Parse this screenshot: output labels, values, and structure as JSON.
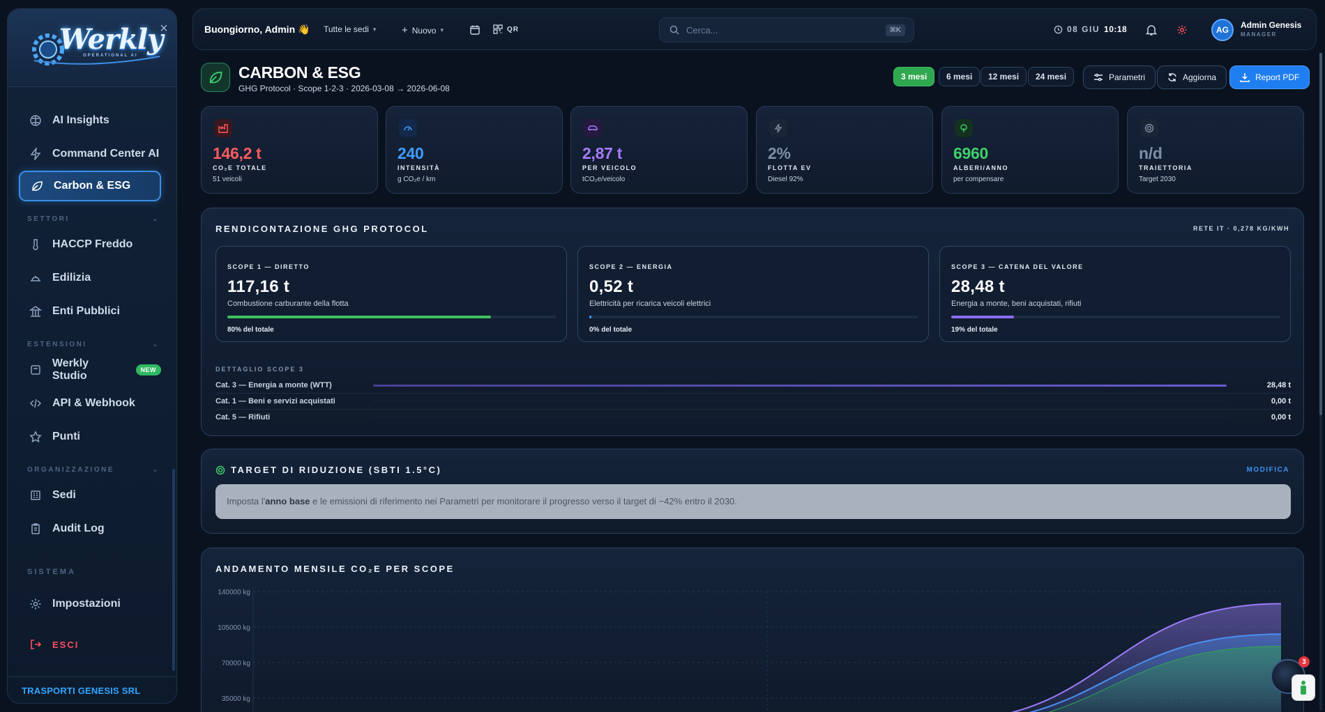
{
  "sidebar": {
    "logo_text": "Werkly",
    "logo_sub": "OPERATIONAL AI",
    "items": [
      {
        "label": "AI Insights",
        "icon": "brain-icon"
      },
      {
        "label": "Command Center AI",
        "icon": "bolt-icon"
      },
      {
        "label": "Carbon & ESG",
        "icon": "leaf-icon"
      },
      {
        "label": "HACCP Freddo",
        "icon": "thermometer-icon"
      },
      {
        "label": "Edilizia",
        "icon": "helmet-icon"
      },
      {
        "label": "Enti Pubblici",
        "icon": "building-icon"
      },
      {
        "label": "Werkly Studio",
        "icon": "studio-icon"
      },
      {
        "label": "API & Webhook",
        "icon": "code-icon"
      },
      {
        "label": "Punti",
        "icon": "star-icon"
      },
      {
        "label": "Sedi",
        "icon": "office-icon"
      },
      {
        "label": "Audit Log",
        "icon": "clipboard-icon"
      },
      {
        "label": "Impostazioni",
        "icon": "gear-icon"
      },
      {
        "label": "ESCI",
        "icon": "logout-icon"
      }
    ],
    "sections": {
      "settori": "SETTORI",
      "estensioni": "ESTENSIONI",
      "organizzazione": "ORGANIZZAZIONE",
      "sistema": "SISTEMA"
    },
    "new_badge": "NEW",
    "footer_company": "TRASPORTI GENESIS SRL",
    "accent": "#3a8ee8"
  },
  "topbar": {
    "greeting": "Buongiorno, Admin 👋",
    "sites_filter": "Tutte le sedi",
    "new_label": "Nuovo",
    "qr_label": "QR",
    "search_placeholder": "Cerca...",
    "search_shortcut": "⌘K",
    "date": "08 GIU",
    "time": "10:18",
    "user_initials": "AG",
    "user_name": "Admin Genesis",
    "user_role": "MANAGER"
  },
  "page": {
    "title": "CARBON & ESG",
    "subtitle": "GHG Protocol · Scope 1-2-3 · 2026-03-08 → 2026-06-08",
    "ranges": [
      "3 mesi",
      "6 mesi",
      "12 mesi",
      "24 mesi"
    ],
    "active_range": "3 mesi",
    "actions": {
      "params": "Parametri",
      "refresh": "Aggiorna",
      "report": "Report PDF"
    }
  },
  "kpis": [
    {
      "value": "146,2 t",
      "label": "CO₂E TOTALE",
      "sub": "51 veicoli",
      "color": "#ff5b60",
      "icon": "factory-icon"
    },
    {
      "value": "240",
      "label": "INTENSITÀ",
      "sub": "g CO₂e / km",
      "color": "#3f9bff",
      "icon": "gauge-icon"
    },
    {
      "value": "2,87 t",
      "label": "PER VEICOLO",
      "sub": "tCO₂e/veicolo",
      "color": "#a87bff",
      "icon": "car-icon"
    },
    {
      "value": "2%",
      "label": "FLOTTA EV",
      "sub": "Diesel 92%",
      "color": "#7d8ea6",
      "icon": "bolt-icon"
    },
    {
      "value": "6960",
      "label": "ALBERI/ANNO",
      "sub": "per compensare",
      "color": "#3fcf6a",
      "icon": "tree-icon"
    },
    {
      "value": "n/d",
      "label": "TRAIETTORIA",
      "sub": "Target 2030",
      "color": "#7d8ea6",
      "icon": "target-icon"
    }
  ],
  "ghg": {
    "title": "RENDICONTAZIONE GHG PROTOCOL",
    "grid_factor": "RETE IT · 0,278 KG/KWH",
    "scopes": [
      {
        "label": "SCOPE 1 — DIRETTO",
        "value": "117,16 t",
        "desc": "Combustione carburante della flotta",
        "pct_label": "80% del totale",
        "share": 0.8,
        "color": "#3fbf5e"
      },
      {
        "label": "SCOPE 2 — ENERGIA",
        "value": "0,52 t",
        "desc": "Elettricità per ricarica veicoli elettrici",
        "pct_label": "0% del totale",
        "share": 0.004,
        "color": "#3f9bff"
      },
      {
        "label": "SCOPE 3 — CATENA DEL VALORE",
        "value": "28,48 t",
        "desc": "Energia a monte, beni acquistati, rifiuti",
        "pct_label": "19% del totale",
        "share": 0.19,
        "color": "#8b6cf0"
      }
    ],
    "scope3_title": "DETTAGLIO SCOPE 3",
    "scope3_rows": [
      {
        "label": "Cat. 3 — Energia a monte (WTT)",
        "value": "28,48 t",
        "share": 1.0
      },
      {
        "label": "Cat. 1 — Beni e servizi acquistati",
        "value": "0,00 t",
        "share": 0
      },
      {
        "label": "Cat. 5 — Rifiuti",
        "value": "0,00 t",
        "share": 0
      }
    ]
  },
  "target": {
    "title": "TARGET DI RIDUZIONE (SBTI 1.5°C)",
    "edit": "MODIFICA",
    "msg_pre": "Imposta l'",
    "msg_bold": "anno base",
    "msg_post": " e le emissioni di riferimento nei Parametri per monitorare il progresso verso il target di −42% entro il 2030."
  },
  "chart_data": {
    "type": "area",
    "title": "ANDAMENTO MENSILE CO₂E PER SCOPE",
    "ylabel": "",
    "y_ticks": [
      "140000 kg",
      "105000 kg",
      "70000 kg",
      "35000 kg"
    ],
    "ylim": [
      0,
      140000
    ],
    "x": [
      0,
      1,
      2,
      3
    ],
    "series": [
      {
        "color": "#9b7cf6",
        "values": [
          0,
          0,
          12000,
          128000
        ]
      },
      {
        "color": "#4b8ff0",
        "values": [
          0,
          0,
          10000,
          98000
        ]
      },
      {
        "color": "#2fa84f",
        "values": [
          0,
          0,
          6000,
          86000
        ]
      }
    ],
    "grid": true
  },
  "assistant": {
    "badge": "3"
  }
}
